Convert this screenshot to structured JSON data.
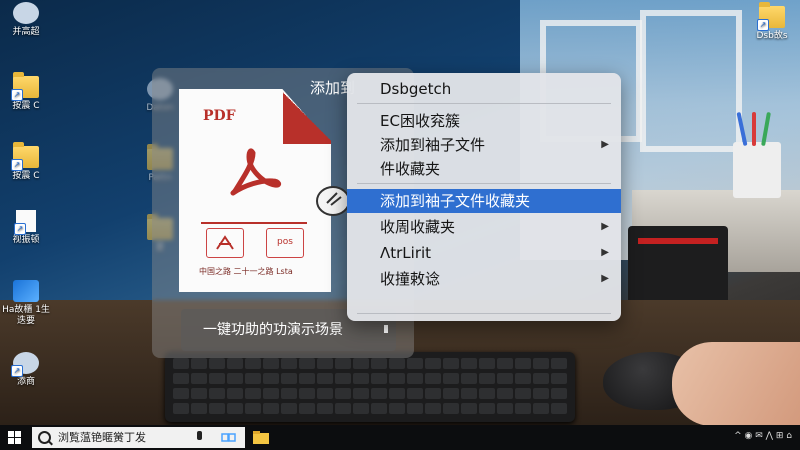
{
  "desktop": {
    "icons": [
      {
        "label": "并高超",
        "kind": "pc"
      },
      {
        "label": "按震 C",
        "kind": "folder"
      },
      {
        "label": "按震 C",
        "kind": "folder"
      },
      {
        "label": "视振顿",
        "kind": "doc"
      },
      {
        "label": "Ha故櫃 1生迭要",
        "kind": "app"
      },
      {
        "label": "添商",
        "kind": "pc"
      },
      {
        "label": "Dsb故s",
        "kind": "folder"
      }
    ],
    "hidden_labels": [
      "Daton",
      "Pattn",
      "要"
    ]
  },
  "preview": {
    "title": "添加到",
    "pdf_label": "PDF",
    "thumb_1": "",
    "thumb_2": "pos",
    "footer": "中国之路 二十一之路 Lsta",
    "action_label": "一键功助的功演示场景"
  },
  "context_menu": {
    "items": [
      {
        "label": "Dsbgetch",
        "submenu": false,
        "selected": false
      },
      {
        "label": "EC困收兖簇",
        "submenu": false,
        "selected": false
      },
      {
        "label": "添加到袖子文件",
        "submenu": true,
        "selected": false
      },
      {
        "label": "件收藏夹",
        "submenu": false,
        "selected": false
      },
      {
        "label": "添加到袖子文件收藏夹",
        "submenu": false,
        "selected": true
      },
      {
        "label": "收周收藏夹",
        "submenu": true,
        "selected": false
      },
      {
        "label": "ΛtrLirit",
        "submenu": true,
        "selected": false
      },
      {
        "label": "收撞敕谂",
        "submenu": true,
        "selected": false
      }
    ],
    "selection_color": "#2f6fd0"
  },
  "taskbar": {
    "search_text": "浏覧蕰铯暱黉丁发",
    "tray_text": "^ ◉ ✉ ⋀ ⊞ ⌂"
  },
  "colors": {
    "pdf_red": "#b8302a",
    "folder": "#e8b73a"
  }
}
